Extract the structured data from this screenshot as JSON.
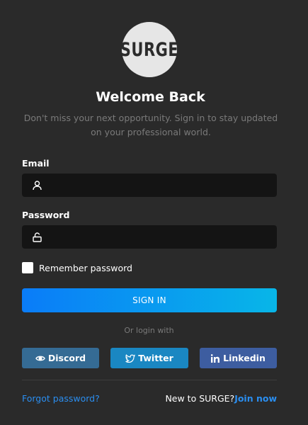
{
  "logo": {
    "text": "SURGE"
  },
  "heading": {
    "title": "Welcome Back",
    "subtitle": "Don't miss your next opportunity. Sign in to stay updated on your professional world."
  },
  "form": {
    "email": {
      "label": "Email",
      "value": "",
      "placeholder": "",
      "icon": "user-icon"
    },
    "password": {
      "label": "Password",
      "value": "",
      "placeholder": "",
      "icon": "lock-icon"
    },
    "remember": {
      "label": "Remember password",
      "checked": false
    },
    "submit_label": "SIGN IN"
  },
  "social": {
    "divider_text": "Or login with",
    "buttons": [
      {
        "label": "Discord",
        "icon": "eye-icon",
        "color": "#356b94"
      },
      {
        "label": "Twitter",
        "icon": "twitter-icon",
        "color": "#1a87c2"
      },
      {
        "label": "Linkedin",
        "icon": "linkedin-icon",
        "color": "#3d5da0"
      }
    ]
  },
  "footer": {
    "forgot_label": "Forgot password?",
    "new_to_label": "New to SURGE?",
    "join_label": "Join now"
  },
  "colors": {
    "background": "#2a2a2a",
    "input_bg": "#141414",
    "accent_blue": "#2a8ef0",
    "button_gradient_start": "#0a7cf8",
    "button_gradient_end": "#08b6e8"
  }
}
